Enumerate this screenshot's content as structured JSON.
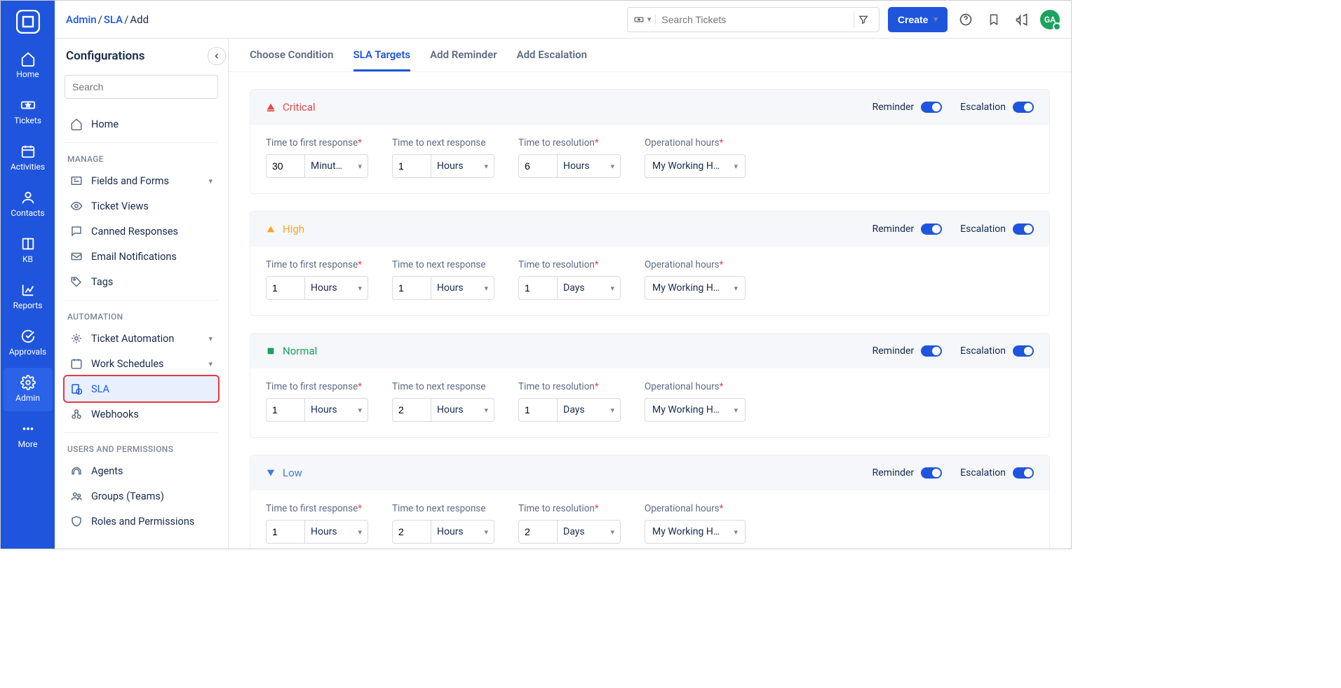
{
  "breadcrumb": {
    "admin": "Admin",
    "sla": "SLA",
    "add": "Add"
  },
  "search": {
    "placeholder": "Search Tickets"
  },
  "create_btn": "Create",
  "avatar": "GA",
  "nav": [
    {
      "label": "Home"
    },
    {
      "label": "Tickets"
    },
    {
      "label": "Activities"
    },
    {
      "label": "Contacts"
    },
    {
      "label": "KB"
    },
    {
      "label": "Reports"
    },
    {
      "label": "Approvals"
    },
    {
      "label": "Admin"
    },
    {
      "label": "More"
    }
  ],
  "sidebar": {
    "title": "Configurations",
    "search_ph": "Search",
    "groups": [
      {
        "title": "",
        "items": [
          {
            "label": "Home"
          }
        ]
      },
      {
        "title": "Manage",
        "items": [
          {
            "label": "Fields and Forms",
            "chev": true
          },
          {
            "label": "Ticket Views"
          },
          {
            "label": "Canned Responses"
          },
          {
            "label": "Email Notifications"
          },
          {
            "label": "Tags"
          }
        ]
      },
      {
        "title": "Automation",
        "items": [
          {
            "label": "Ticket Automation",
            "chev": true
          },
          {
            "label": "Work Schedules",
            "chev": true
          },
          {
            "label": "SLA",
            "active": true
          },
          {
            "label": "Webhooks"
          }
        ]
      },
      {
        "title": "Users and Permissions",
        "items": [
          {
            "label": "Agents"
          },
          {
            "label": "Groups (Teams)"
          },
          {
            "label": "Roles and Permissions"
          }
        ]
      }
    ]
  },
  "tabs": [
    "Choose Condition",
    "SLA Targets",
    "Add Reminder",
    "Add Escalation"
  ],
  "labels": {
    "reminder": "Reminder",
    "escalation": "Escalation",
    "t_first": "Time to first response",
    "t_next": "Time to next response",
    "t_res": "Time to resolution",
    "op_hours": "Operational hours"
  },
  "priorities": [
    {
      "name": "Critical",
      "cls": "critical",
      "first_v": "30",
      "first_u": "Minut…",
      "next_v": "1",
      "next_u": "Hours",
      "res_v": "6",
      "res_u": "Hours",
      "op": "My Working H…"
    },
    {
      "name": "High",
      "cls": "high",
      "first_v": "1",
      "first_u": "Hours",
      "next_v": "1",
      "next_u": "Hours",
      "res_v": "1",
      "res_u": "Days",
      "op": "My Working H…"
    },
    {
      "name": "Normal",
      "cls": "normal",
      "first_v": "1",
      "first_u": "Hours",
      "next_v": "2",
      "next_u": "Hours",
      "res_v": "1",
      "res_u": "Days",
      "op": "My Working H…"
    },
    {
      "name": "Low",
      "cls": "low",
      "first_v": "1",
      "first_u": "Hours",
      "next_v": "2",
      "next_u": "Hours",
      "res_v": "2",
      "res_u": "Days",
      "op": "My Working H…"
    }
  ]
}
